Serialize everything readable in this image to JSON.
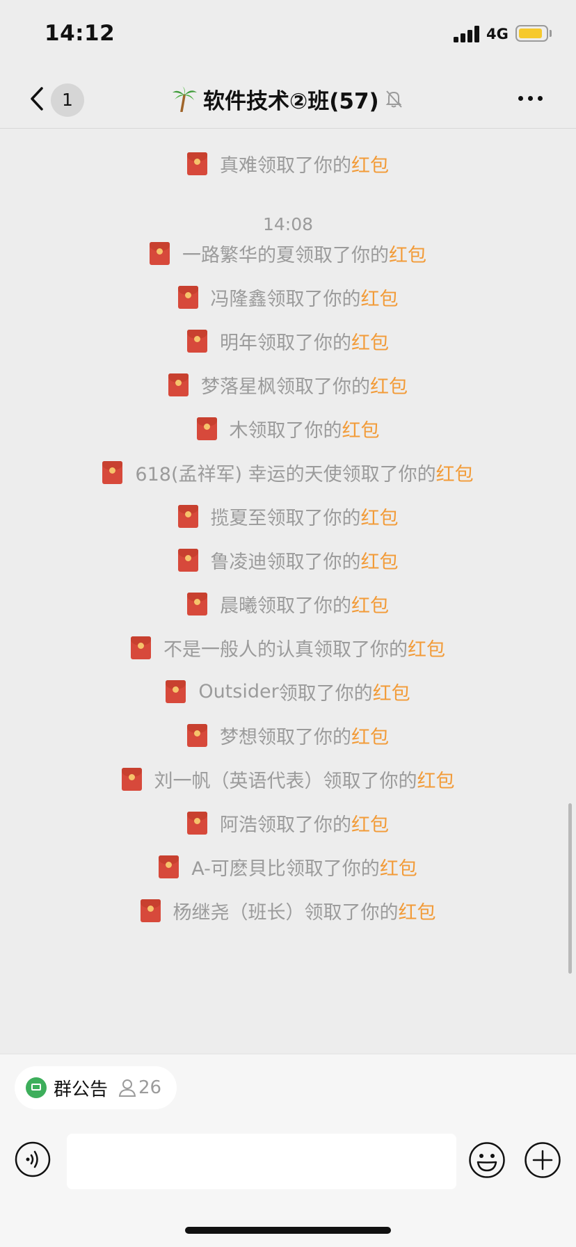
{
  "status_bar": {
    "time": "14:12",
    "network": "4G"
  },
  "nav": {
    "unread_count": "1",
    "title": "软件技术②班(57)"
  },
  "chat": {
    "message_suffix": "领取了你的",
    "red_packet_word": "红包",
    "timestamp": "14:08",
    "top_message_name": "真难",
    "messages": [
      {
        "name": "一路繁华的夏"
      },
      {
        "name": "冯隆鑫"
      },
      {
        "name": "明年"
      },
      {
        "name": "梦落星枫"
      },
      {
        "name": "木"
      },
      {
        "name": "618(孟祥军) 幸运的天使"
      },
      {
        "name": "揽夏至"
      },
      {
        "name": "鲁凌迪"
      },
      {
        "name": "晨曦"
      },
      {
        "name": "不是一般人的认真"
      },
      {
        "name": "Outsider"
      },
      {
        "name": "梦想"
      },
      {
        "name": "刘一帆（英语代表）"
      },
      {
        "name": "阿浩"
      },
      {
        "name": "A-可麽貝比"
      },
      {
        "name": "杨继尧（班长）"
      }
    ]
  },
  "bottom": {
    "notice_label": "群公告",
    "notice_count": "26"
  },
  "colors": {
    "red_packet_word": "#f29b38",
    "notice_icon": "#3dae5b",
    "red_packet_icon": "#d7493b"
  }
}
